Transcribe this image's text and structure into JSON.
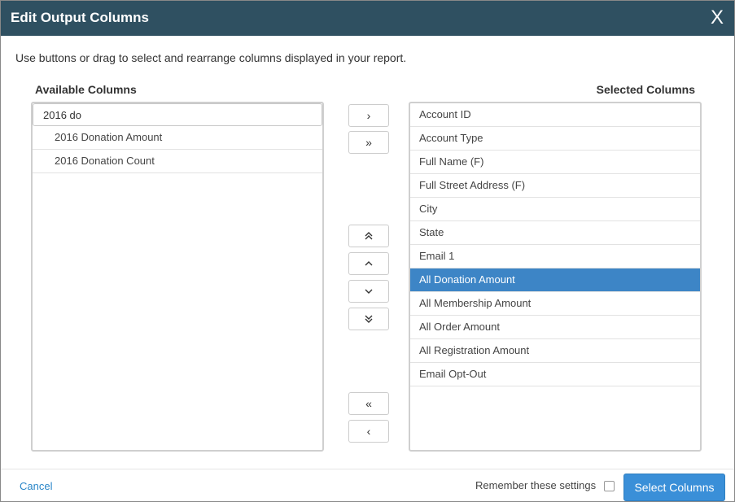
{
  "dialog": {
    "title": "Edit Output Columns",
    "close_label": "X"
  },
  "instructions": "Use buttons or drag to select and rearrange columns displayed in your report.",
  "available": {
    "heading": "Available Columns",
    "filter_value": "2016 do",
    "items": [
      {
        "label": "2016 Donation Amount"
      },
      {
        "label": "2016 Donation Count"
      }
    ]
  },
  "selected": {
    "heading": "Selected Columns",
    "active_index": 7,
    "items": [
      {
        "label": "Account ID"
      },
      {
        "label": "Account Type"
      },
      {
        "label": "Full Name (F)"
      },
      {
        "label": "Full Street Address (F)"
      },
      {
        "label": "City"
      },
      {
        "label": "State"
      },
      {
        "label": "Email 1"
      },
      {
        "label": "All Donation Amount"
      },
      {
        "label": "All Membership Amount"
      },
      {
        "label": "All Order Amount"
      },
      {
        "label": "All Registration Amount"
      },
      {
        "label": "Email Opt-Out"
      }
    ]
  },
  "move_buttons": {
    "add": "›",
    "add_all": "»",
    "move_top": "⌃⌃",
    "move_up": "⌃",
    "move_down": "⌄",
    "move_bottom": "⌄⌄",
    "remove_all": "«",
    "remove": "‹"
  },
  "footer": {
    "cancel": "Cancel",
    "remember": "Remember these settings",
    "remember_checked": false,
    "submit": "Select Columns"
  },
  "colors": {
    "titlebar": "#2f5061",
    "highlight": "#3d85c6",
    "primary": "#3a8fd8",
    "link": "#2a86c8"
  }
}
